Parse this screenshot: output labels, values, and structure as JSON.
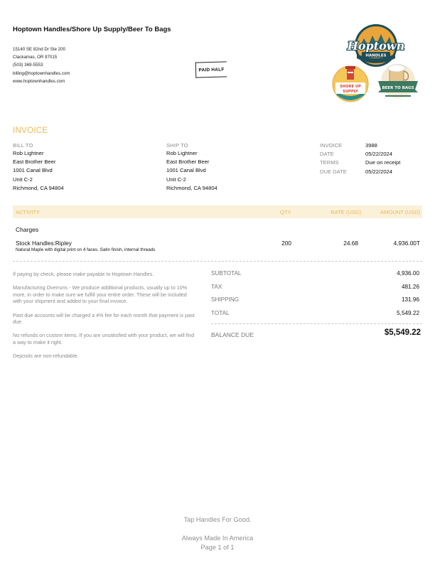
{
  "company": {
    "name": "Hoptown Handles/Shore Up Supply/Beer To Bags",
    "address_line1": "15140 SE 82nd Dr Ste 200",
    "address_line2": "Clackamas, OR 97015",
    "phone": "(503) 369-5553",
    "email": "billing@hoptownhandles.com",
    "website": "www.hoptownhandles.com"
  },
  "stamp": "PAID HALF",
  "logos": {
    "main": "Hoptown",
    "main_sub": "HANDLES",
    "left_badge": "SHORE UP SUPPLY",
    "right_badge": "BEER TO BAGS"
  },
  "invoice_title": "INVOICE",
  "bill_to": {
    "label": "BILL TO",
    "lines": [
      "Rob Lightner",
      "East Brother Beer",
      "1001 Canal Blvd",
      "Unit C-2",
      "Richmond, CA 94804"
    ]
  },
  "ship_to": {
    "label": "SHIP TO",
    "lines": [
      "Rob Lightner",
      "East Brother Beer",
      "1001 Canal Blvd",
      "Unit C-2",
      "Richmond, CA 94804"
    ]
  },
  "meta": [
    {
      "label": "INVOICE",
      "value": "3988"
    },
    {
      "label": "DATE",
      "value": "05/22/2024"
    },
    {
      "label": "TERMS",
      "value": "Due on receipt"
    },
    {
      "label": "DUE DATE",
      "value": "05/22/2024"
    }
  ],
  "table": {
    "headers": {
      "activity": "ACTIVITY",
      "qty": "QTY",
      "rate": "RATE (USD)",
      "amount": "AMOUNT (USD)"
    },
    "section": "Charges",
    "items": [
      {
        "name": "Stock Handles:Ripley",
        "description": "Natural Maple with digital print on 4 faces. Satin finish, internal threads",
        "qty": "200",
        "rate": "24.68",
        "amount": "4,936.00T"
      }
    ]
  },
  "notes": [
    "If paying by check, please make payable to Hoptown Handles.",
    "Manufacturing Overruns - We produce additional products, usually up to 10% more, in order to make sure we fulfill your entire order.  These will be included with your shipment and added to your final invoice.",
    "Past due accounts will be charged a 4% fee for each month that payment is past due.",
    "No refunds on custom items.  If you are unsatisfied with your product, we will find a way to make it right.",
    "Deposits are non-refundable."
  ],
  "totals": [
    {
      "label": "SUBTOTAL",
      "value": "4,936.00"
    },
    {
      "label": "TAX",
      "value": "481.26"
    },
    {
      "label": "SHIPPING",
      "value": "131.96"
    },
    {
      "label": "TOTAL",
      "value": "5,549.22"
    }
  ],
  "balance_due": {
    "label": "BALANCE DUE",
    "value": "$5,549.22"
  },
  "footer": {
    "tagline": "Tap Handles For Good.",
    "made_in": "Always Made In America",
    "page": "Page 1 of 1"
  },
  "colors": {
    "accent": "#e8ba55",
    "header_band": "#fbf0d8",
    "muted": "#8a8a8a"
  }
}
